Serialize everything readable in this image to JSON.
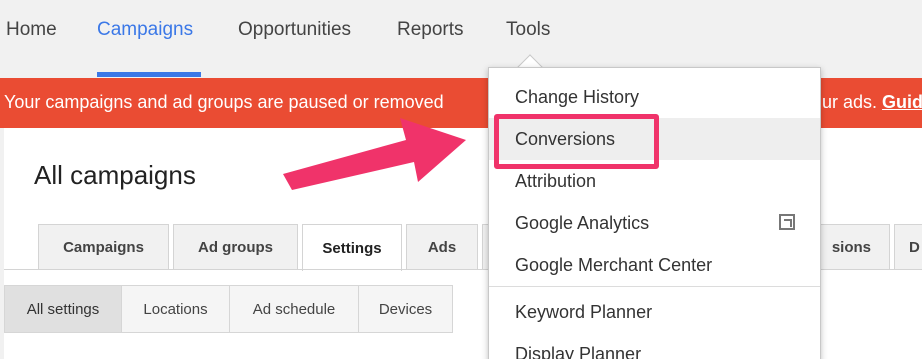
{
  "topnav": {
    "items": [
      {
        "label": "Home"
      },
      {
        "label": "Campaigns"
      },
      {
        "label": "Opportunities"
      },
      {
        "label": "Reports"
      },
      {
        "label": "Tools"
      }
    ]
  },
  "alert": {
    "text": "Your campaigns and ad groups are paused or removed",
    "text_right": "ur ads.",
    "link": "Guid"
  },
  "main": {
    "title": "All campaigns",
    "tabs": [
      {
        "label": "Campaigns"
      },
      {
        "label": "Ad groups"
      },
      {
        "label": "Settings"
      },
      {
        "label": "Ads"
      },
      {
        "label": "sions"
      },
      {
        "label": "D"
      }
    ],
    "subtabs": [
      {
        "label": "All settings"
      },
      {
        "label": "Locations"
      },
      {
        "label": "Ad schedule"
      },
      {
        "label": "Devices"
      }
    ]
  },
  "tools_menu": {
    "items": [
      {
        "label": "Change History"
      },
      {
        "label": "Conversions"
      },
      {
        "label": "Attribution"
      },
      {
        "label": "Google Analytics"
      },
      {
        "label": "Google Merchant Center"
      },
      {
        "label": "Keyword Planner"
      },
      {
        "label": "Display Planner"
      }
    ]
  },
  "colors": {
    "accent": "#3b78e7",
    "alert": "#ea4c33",
    "highlight": "#f0336a"
  }
}
